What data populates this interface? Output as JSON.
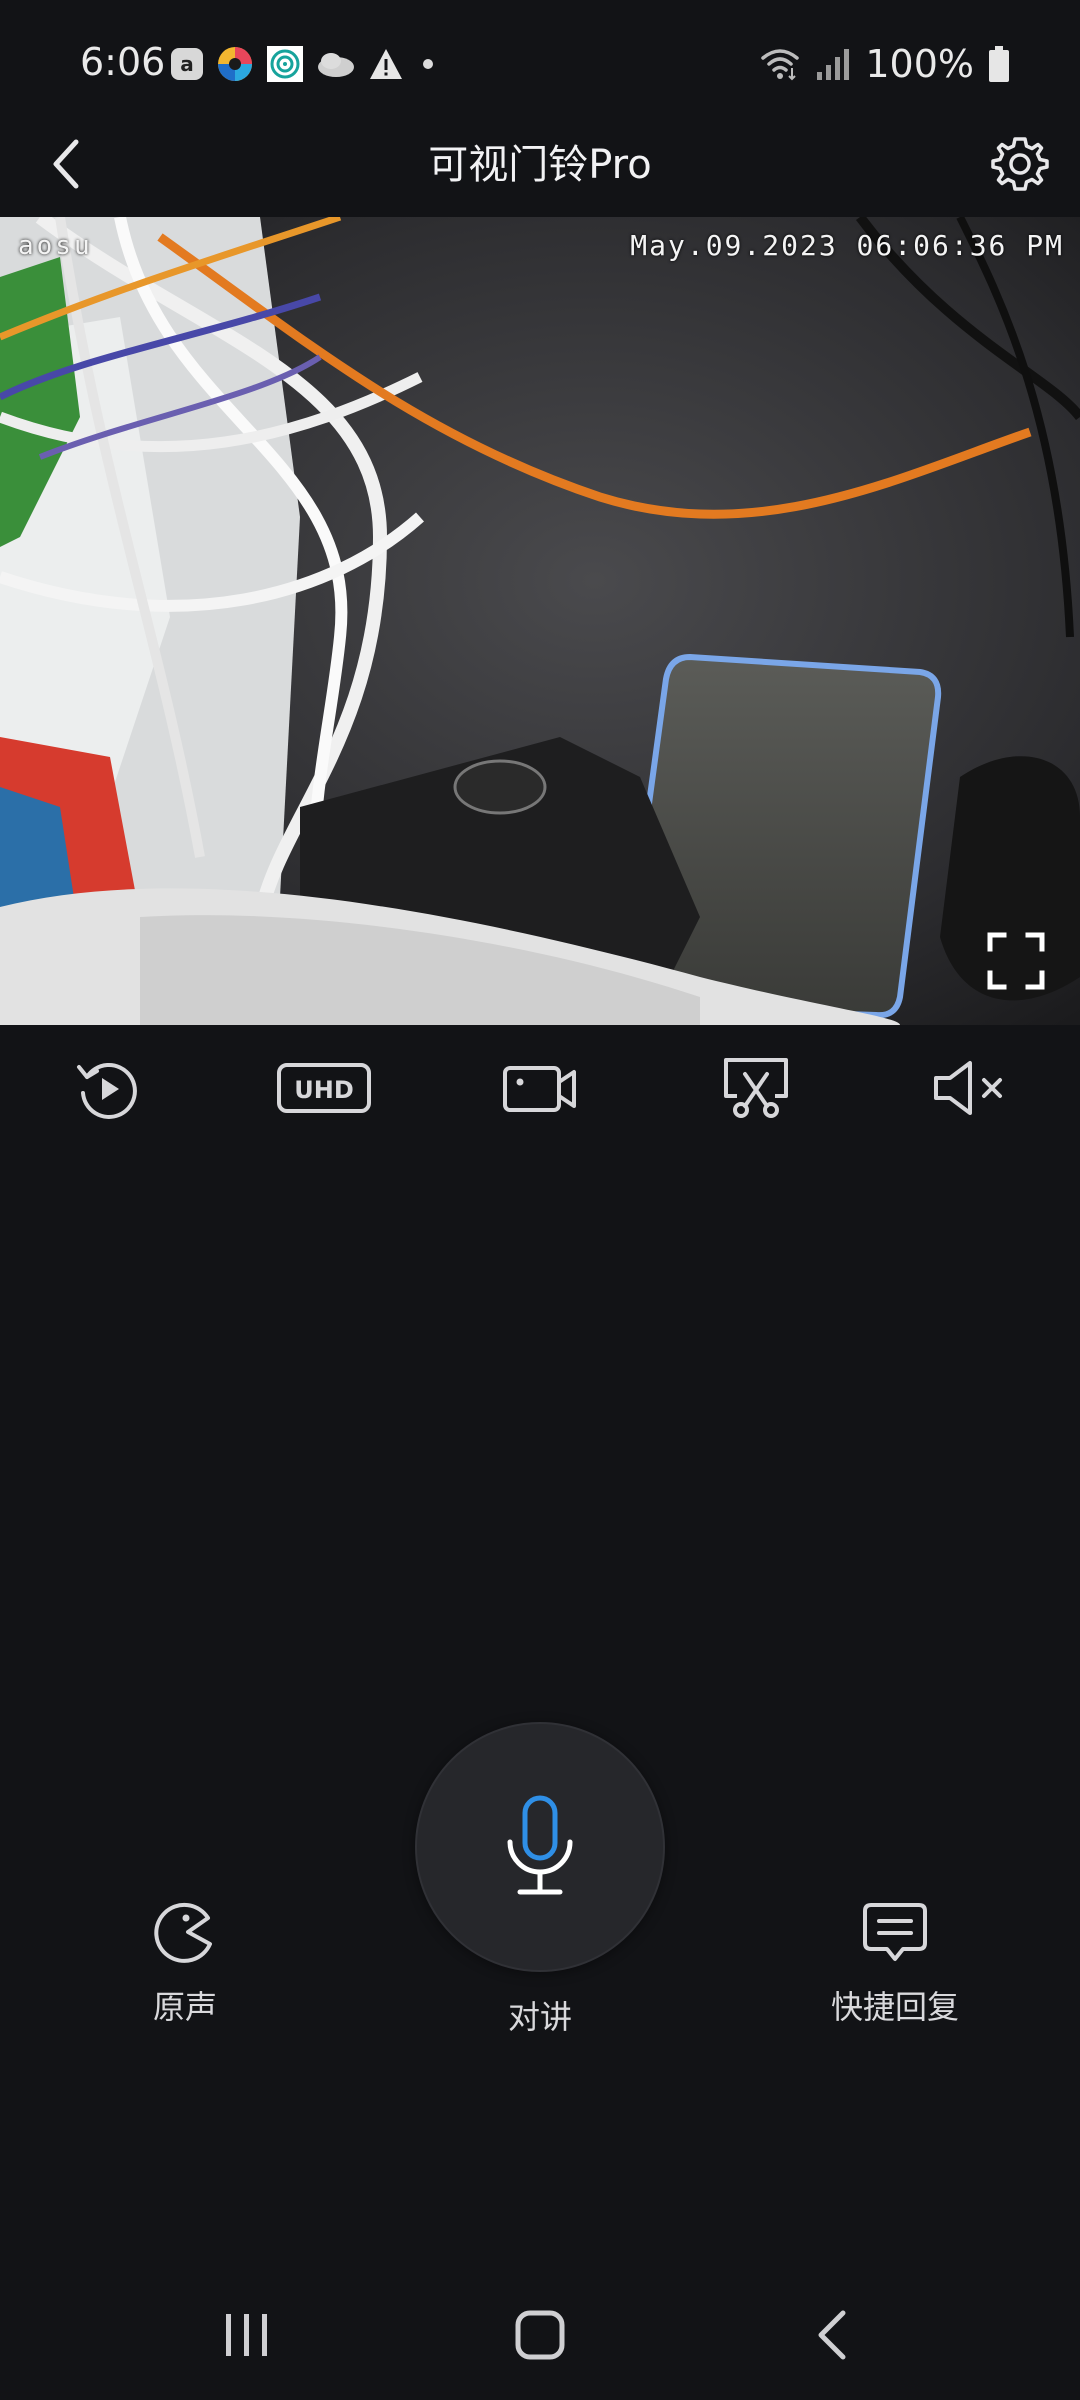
{
  "status_bar": {
    "time": "6:06",
    "battery": "100%",
    "left_icons": [
      "a-app-icon",
      "color-wheel-app-icon",
      "target-app-icon",
      "cloud-app-icon",
      "warning-icon",
      "dot-icon"
    ],
    "right_icons": [
      "wifi-icon",
      "signal-icon",
      "battery-icon"
    ]
  },
  "header": {
    "title": "可视门铃Pro",
    "back_icon": "chevron-left-icon",
    "settings_icon": "gear-icon"
  },
  "video": {
    "brand": "aosu",
    "timestamp": "May.09.2023 06:06:36 PM",
    "fullscreen_icon": "fullscreen-icon"
  },
  "toolbar": {
    "items": [
      {
        "name": "playback",
        "icon": "replay-icon"
      },
      {
        "name": "quality",
        "icon": "uhd-icon",
        "label": "UHD"
      },
      {
        "name": "record",
        "icon": "video-camera-icon"
      },
      {
        "name": "screenshot",
        "icon": "scissors-screen-icon"
      },
      {
        "name": "mute",
        "icon": "speaker-muted-icon"
      }
    ]
  },
  "controls": {
    "original_voice": {
      "label": "原声",
      "icon": "voice-pacman-icon"
    },
    "talk": {
      "label": "对讲",
      "icon": "microphone-icon"
    },
    "quick_reply": {
      "label": "快捷回复",
      "icon": "chat-bubble-icon"
    }
  },
  "colors": {
    "background": "#121316",
    "accent_mic": "#2f8fe6",
    "text": "#e8e8ea"
  },
  "nav_bar": {
    "buttons": [
      "recent-apps-icon",
      "home-icon",
      "back-icon"
    ]
  }
}
